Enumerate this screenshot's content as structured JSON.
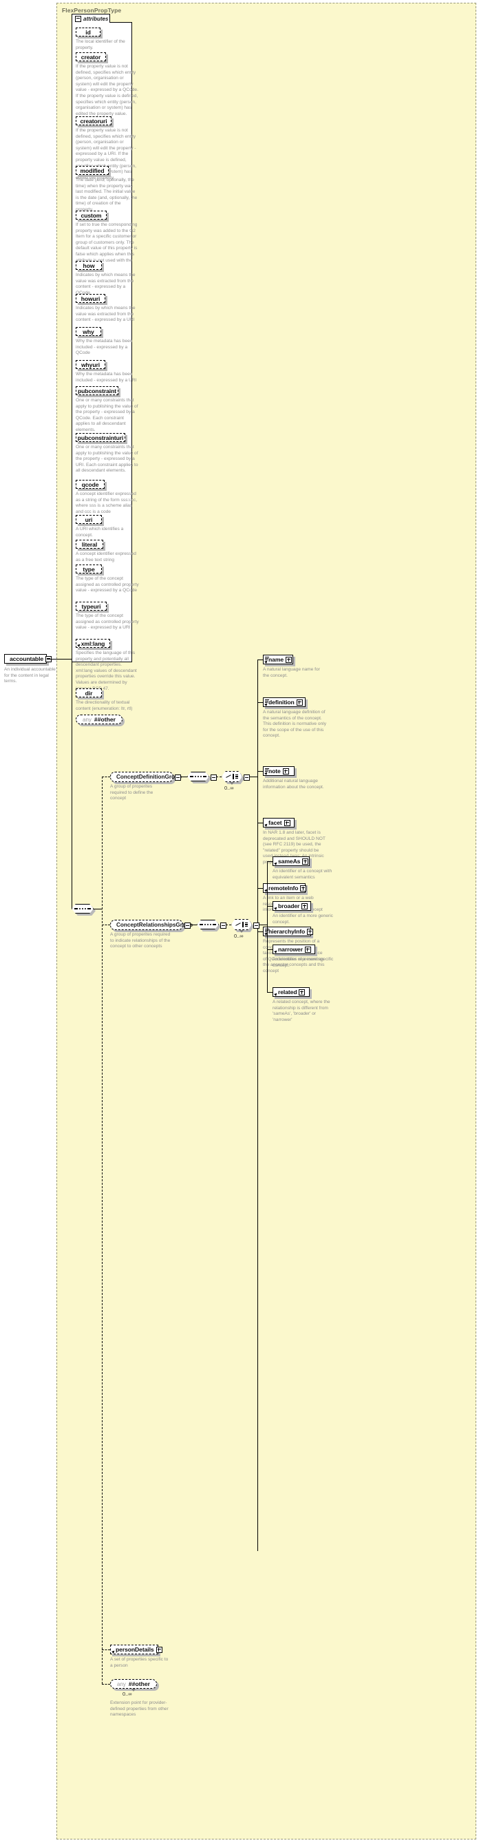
{
  "diagram": {
    "title": "FlexPersonPropType",
    "root_element": {
      "name": "accountable",
      "doc": "An individual accountable for the content in legal terms."
    },
    "attributes_panel": {
      "label": "attributes",
      "toggle": "minus"
    },
    "attributes": [
      {
        "name": "id",
        "doc": "The local identifier of the property."
      },
      {
        "name": "creator",
        "doc": "If the property value is not defined, specifies which entity (person, organisation or system) will edit the property value - expressed by a QCode. If the property value is defined, specifies which entity (person, organisation or system) has edited the property value."
      },
      {
        "name": "creatoruri",
        "doc": "If the property value is not defined, specifies which entity (person, organisation or system) will edit the property - expressed by a URI. If the property value is defined, specifies which entity (person, organisation or system) has edited the property."
      },
      {
        "name": "modified",
        "doc": "The date (and, optionally, the time) when the property was last modified. The initial value is the date (and, optionally, the time) of creation of the property."
      },
      {
        "name": "custom",
        "doc": "If set to true the corresponding property was added to the G2 Item for a specific customer or group of customers only. The default value of this property is false which applies when this attribute is not used with the property."
      },
      {
        "name": "how",
        "doc": "Indicates by which means the value was extracted from the content - expressed by a QCode"
      },
      {
        "name": "howuri",
        "doc": "Indicates by which means the value was extracted from the content - expressed by a URI"
      },
      {
        "name": "why",
        "doc": "Why the metadata has been included - expressed by a QCode"
      },
      {
        "name": "whyuri",
        "doc": "Why the metadata has been included - expressed by a URI"
      },
      {
        "name": "pubconstraint",
        "doc": "One or many constraints that apply to publishing the value of the property - expressed by a QCode. Each constraint applies to all descendant elements."
      },
      {
        "name": "pubconstrainturi",
        "doc": "One or many constraints that apply to publishing the value of the property - expressed by a URI. Each constraint applies to all descendant elements."
      },
      {
        "name": "qcode",
        "doc": "A concept identifier expressed as a string of the form sss:ccc, where sss is a scheme alias and ccc is a code"
      },
      {
        "name": "uri",
        "doc": "A URI which identifies a concept."
      },
      {
        "name": "literal",
        "doc": "A concept identifier expressed as a free text string"
      },
      {
        "name": "type",
        "doc": "The type of the concept assigned as controlled property value - expressed by a QCode"
      },
      {
        "name": "typeuri",
        "doc": "The type of the concept assigned as controlled property value - expressed by a URI"
      },
      {
        "name": "xml:lang",
        "doc": "Specifies the language of this property and potentially all descendant properties. xml:lang values of descendant properties override this value. Values are determined by Internet BCP 47."
      },
      {
        "name": "dir",
        "doc": "The directionality of textual content (enumeration: ltr, rtl)"
      }
    ],
    "attributes_any": {
      "any_label": "any",
      "name": "##other"
    },
    "groups": [
      {
        "id": "concept-definition-group",
        "name": "ConceptDefinitionGroup",
        "doc": "A group of properites required to define the concept",
        "cardinality": "0..∞",
        "children": [
          {
            "name": "name",
            "doc": "A natural language name for the concept.",
            "lines": true
          },
          {
            "name": "definition",
            "doc": "A natural language definition of the semantics of the concept. This definition is normative only for the scope of the use of this concept.",
            "lines": true
          },
          {
            "name": "note",
            "doc": "Additional natural language information about the concept.",
            "lines": true
          },
          {
            "name": "facet",
            "doc": "In NAR 1.8 and later, facet is deprecated and SHOULD NOT (see RFC 2119) be used, the \"related\" property should be used instead (was: An intrinsic property of the concept.)",
            "lines": false
          },
          {
            "name": "remoteInfo",
            "doc": "A link to an item or a web resource which provides information about the concept",
            "lines": false
          },
          {
            "name": "hierarchyInfo",
            "doc": "Represents the position of a concept in a hierarchical taxonomy tree by a sequence of QCode tokens representing the ancestor concepts and this concept",
            "lines": true
          }
        ]
      },
      {
        "id": "concept-relationships-group",
        "name": "ConceptRelationshipsGroup",
        "doc": "A group of properites required to indicate relationships of the concept to other concepts",
        "cardinality": "0..∞",
        "children": [
          {
            "name": "sameAs",
            "doc": "An identifier of a concept with equivalent semantics",
            "lines": false
          },
          {
            "name": "broader",
            "doc": "An identifier of a more generic concept.",
            "lines": false
          },
          {
            "name": "narrower",
            "doc": "An identifier of a more specific concept.",
            "lines": false
          },
          {
            "name": "related",
            "doc": "A related concept, where the relationship is different from 'sameAs', 'broader' or 'narrower'",
            "lines": false
          }
        ]
      }
    ],
    "person_details": {
      "name": "personDetails",
      "doc": "A set of properties specific to a person"
    },
    "content_any": {
      "any_label": "any",
      "name": "##other",
      "cardinality": "0..∞",
      "doc": "Extension point for provider-defined properties from other namespaces"
    },
    "colors": {
      "group_bg": "#fbf8cc",
      "group_border": "#9a9a7a",
      "doc_text": "#8d8d8d",
      "title_text": "#6e6e5a",
      "shadow": "#b9b9b9"
    }
  }
}
